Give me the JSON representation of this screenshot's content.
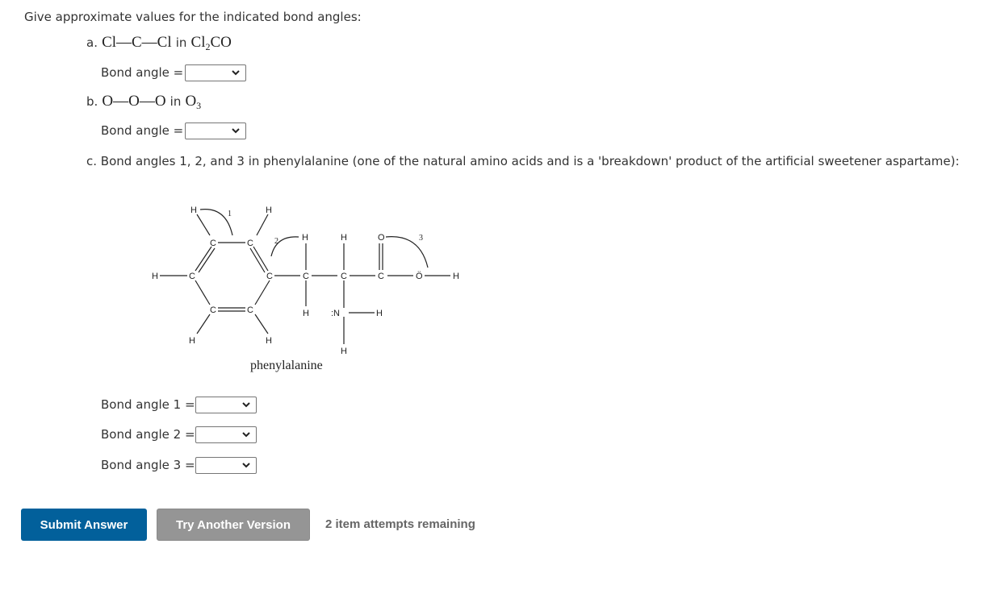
{
  "question": {
    "prompt": "Give approximate values for the indicated bond angles:",
    "parts": [
      {
        "label": "a.",
        "formula_parts": [
          "Cl—C—Cl"
        ],
        "in_text": "in",
        "molecule": "Cl",
        "molecule_sub": "2",
        "molecule_tail": "CO",
        "answer_label": "Bond angle =",
        "selected": ""
      },
      {
        "label": "b.",
        "formula_parts": [
          "O—O—O"
        ],
        "in_text": "in",
        "molecule": "O",
        "molecule_sub": "3",
        "molecule_tail": "",
        "answer_label": "Bond angle =",
        "selected": ""
      }
    ],
    "part_c": {
      "text": "c. Bond angles 1, 2, and 3 in phenylalanine (one of the natural amino acids and is a 'breakdown' product of the artificial sweetener aspartame):",
      "figure_caption": "phenylalanine",
      "angle_markers": [
        "1",
        "2",
        "3"
      ],
      "atoms": {
        "C": "C",
        "H": "H",
        "N": ":N",
        "O": "O",
        "O_lone": "Ö"
      },
      "answers": [
        {
          "label": "Bond angle 1 =",
          "selected": ""
        },
        {
          "label": "Bond angle 2 =",
          "selected": ""
        },
        {
          "label": "Bond angle 3 =",
          "selected": ""
        }
      ]
    }
  },
  "actions": {
    "submit_label": "Submit Answer",
    "try_another_label": "Try Another Version",
    "attempts_text": "2 item attempts remaining"
  },
  "colors": {
    "submit": "#02609b",
    "try_another": "#959595"
  }
}
